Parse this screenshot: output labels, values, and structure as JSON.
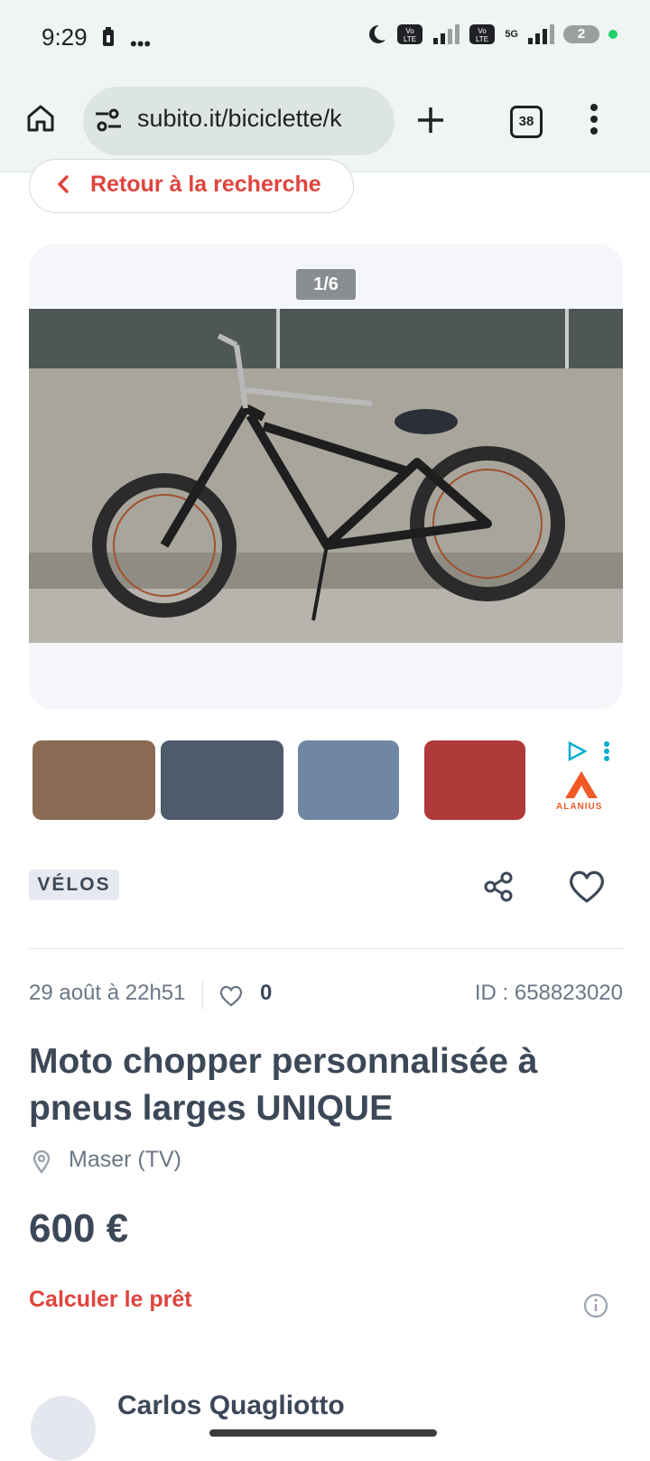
{
  "status_bar": {
    "time": "9:29",
    "battery": "2",
    "network": "5G"
  },
  "browser": {
    "url": "subito.it/biciclette/k",
    "tab_count": "38"
  },
  "back": {
    "label": "Retour à la recherche"
  },
  "gallery": {
    "counter": "1/6"
  },
  "ad": {
    "brand": "ALANIUS"
  },
  "listing": {
    "category": "VÉLOS",
    "date": "29 août à 22h51",
    "likes": "0",
    "id": "ID : 658823020",
    "title": "Moto chopper personnalisée à pneus larges UNIQUE",
    "location": "Maser (TV)",
    "price": "600 €",
    "loan_link": "Calculer le prêt"
  },
  "seller": {
    "name": "Carlos Quagliotto"
  },
  "colors": {
    "accent": "#e0443d",
    "text": "#3c4858",
    "muted": "#6b7685"
  }
}
